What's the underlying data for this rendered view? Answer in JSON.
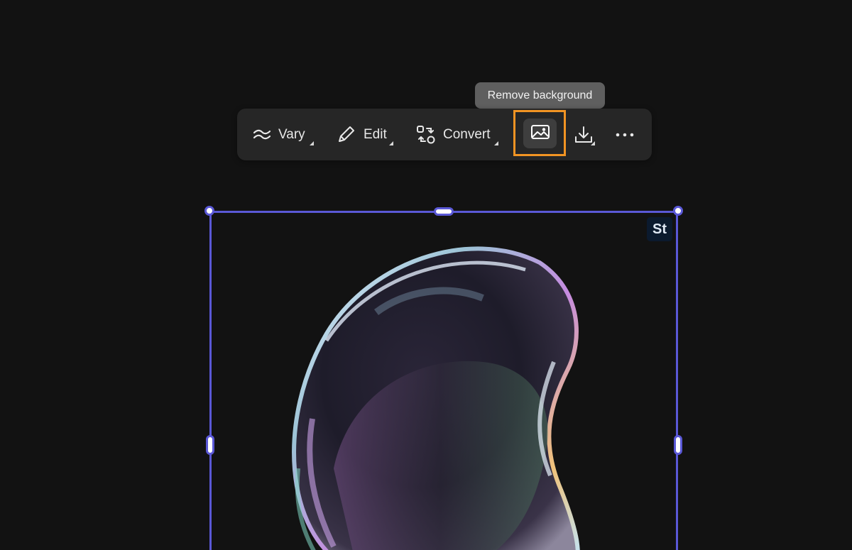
{
  "tooltip": {
    "text": "Remove background"
  },
  "toolbar": {
    "vary_label": "Vary",
    "edit_label": "Edit",
    "convert_label": "Convert",
    "remove_background_icon": "image-icon",
    "download_icon": "download-icon",
    "more_icon": "more-icon",
    "highlight_color": "#f29423"
  },
  "badge": {
    "text": "St"
  },
  "selection": {
    "color": "#5a58d6"
  }
}
